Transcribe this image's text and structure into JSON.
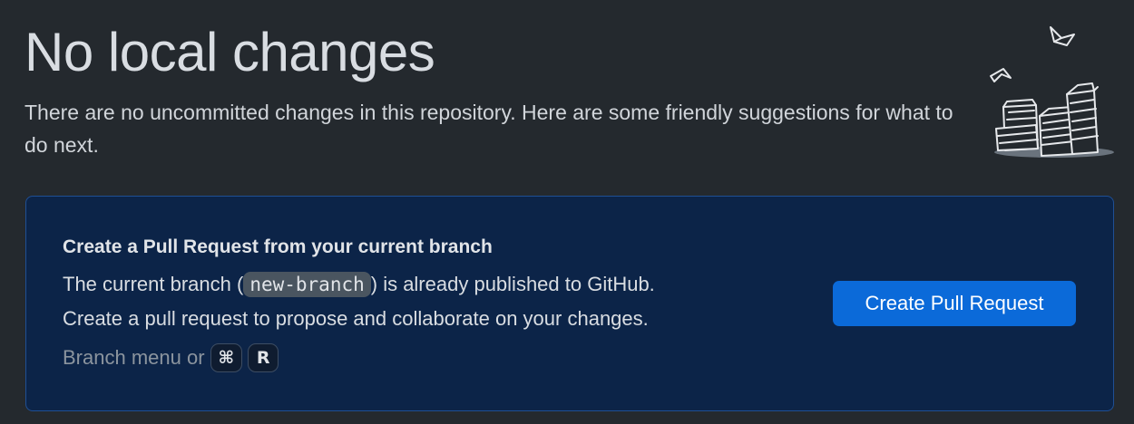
{
  "page": {
    "title": "No local changes",
    "description": "There are no uncommitted changes in this repository. Here are some friendly suggestions for what to do next."
  },
  "illustration": {
    "icon": "paper-stacks-icon"
  },
  "suggestion": {
    "title": "Create a Pull Request from your current branch",
    "desc_line1_before": "The current branch (",
    "branch_name": "new-branch",
    "desc_line1_after": ") is already published to GitHub.",
    "desc_line2": "Create a pull request to propose and collaborate on your changes.",
    "shortcut_label": "Branch menu or",
    "shortcut_keys": [
      "⌘",
      "R"
    ],
    "button_label": "Create Pull Request"
  },
  "colors": {
    "background": "#24292e",
    "card_background": "#0c2448",
    "card_border": "#1f4f94",
    "button": "#0b6ad9"
  }
}
